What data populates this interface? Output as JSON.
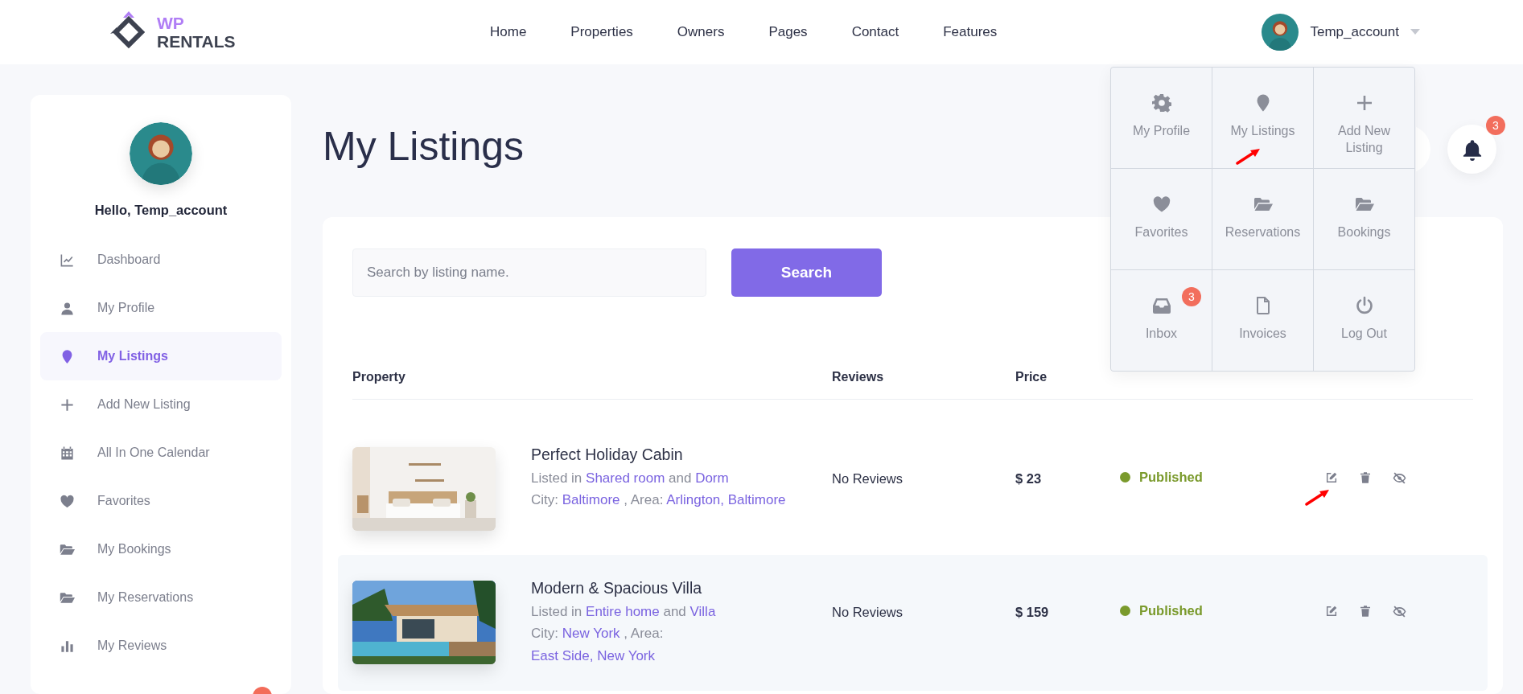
{
  "header": {
    "logo": {
      "top": "WP",
      "bottom": "RENTALS"
    },
    "nav": [
      "Home",
      "Properties",
      "Owners",
      "Pages",
      "Contact",
      "Features"
    ],
    "account": "Temp_account"
  },
  "sidebar": {
    "greeting": "Hello, Temp_account",
    "items": [
      {
        "label": "Dashboard",
        "selected": false
      },
      {
        "label": "My Profile",
        "selected": false
      },
      {
        "label": "My Listings",
        "selected": true
      },
      {
        "label": "Add New Listing",
        "selected": false
      },
      {
        "label": "All In One Calendar",
        "selected": false
      },
      {
        "label": "Favorites",
        "selected": false
      },
      {
        "label": "My Bookings",
        "selected": false
      },
      {
        "label": "My Reservations",
        "selected": false
      },
      {
        "label": "My Reviews",
        "selected": false
      }
    ]
  },
  "page_title": "My Listings",
  "search": {
    "placeholder": "Search by listing name.",
    "button": "Search"
  },
  "table": {
    "columns": [
      "Property",
      "Reviews",
      "Price"
    ],
    "rows": [
      {
        "title": "Perfect Holiday Cabin",
        "listed_prefix": "Listed in",
        "type": "Shared room",
        "joiner": "and",
        "category": "Dorm",
        "city_label": "City:",
        "city": "Baltimore",
        "area_label": ", Area:",
        "area": "Arlington, Baltimore",
        "reviews": "No Reviews",
        "price": "$ 23",
        "status": {
          "label": "Published",
          "color": "#7a9a2c"
        },
        "highlighted": false
      },
      {
        "title": "Modern & Spacious Villa",
        "listed_prefix": "Listed in",
        "type": "Entire home",
        "joiner": "and",
        "category": "Villa",
        "city_label": "City:",
        "city": "New York",
        "area_label": ", Area:",
        "area": "East Side, New York",
        "reviews": "No Reviews",
        "price": "$ 159",
        "status": {
          "label": "Published",
          "color": "#7a9a2c"
        },
        "highlighted": true
      }
    ]
  },
  "user_menu": {
    "items": [
      {
        "label": "My Profile"
      },
      {
        "label": "My Listings"
      },
      {
        "label": "Add New Listing"
      },
      {
        "label": "Favorites"
      },
      {
        "label": "Reservations"
      },
      {
        "label": "Bookings"
      },
      {
        "label": "Inbox",
        "badge": "3"
      },
      {
        "label": "Invoices"
      },
      {
        "label": "Log Out"
      }
    ]
  },
  "notifications": {
    "badge": "3"
  }
}
